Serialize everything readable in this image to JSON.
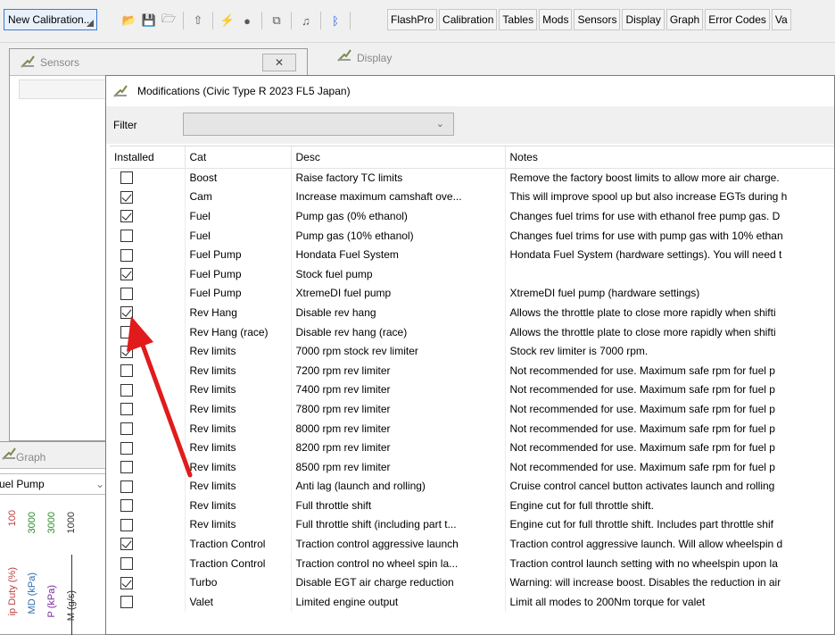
{
  "toolbar": {
    "new_calibration": "New Calibration...",
    "icons": [
      "open-folder-icon",
      "save-icon",
      "save-all-icon",
      "upload-icon",
      "flash-icon",
      "record-icon",
      "copy-icon",
      "music-icon",
      "bluetooth-icon"
    ],
    "menus": [
      "FlashPro",
      "Calibration",
      "Tables",
      "Mods",
      "Sensors",
      "Display",
      "Graph",
      "Error Codes",
      "Va"
    ]
  },
  "sensors_window": {
    "title": "Sensors",
    "close": "✕"
  },
  "display_window": {
    "title": "Display"
  },
  "graph_window": {
    "title": "Graph",
    "selected": "uel Pump",
    "axis_labels": [
      "100",
      "3000",
      "3000",
      "1000",
      "ip Duty (%)",
      "MD (kPa)",
      "P (kPa)",
      "M (g/s)"
    ]
  },
  "dialog": {
    "title": "Modifications (Civic Type R 2023 FL5 Japan)",
    "filter_label": "Filter",
    "filter_value": "",
    "columns": [
      "Installed",
      "Cat",
      "Desc",
      "Notes"
    ],
    "rows": [
      {
        "installed": false,
        "cat": "Boost",
        "desc": "Raise factory TC limits",
        "notes": "Remove the factory boost limits to allow more air charge."
      },
      {
        "installed": true,
        "cat": "Cam",
        "desc": "Increase maximum camshaft ove...",
        "notes": "This will improve spool up but also increase EGTs during h"
      },
      {
        "installed": true,
        "cat": "Fuel",
        "desc": "Pump gas (0% ethanol)",
        "notes": "Changes fuel trims for use with ethanol free pump gas.  D"
      },
      {
        "installed": false,
        "cat": "Fuel",
        "desc": "Pump gas (10% ethanol)",
        "notes": "Changes fuel trims for use with pump gas with 10% ethan"
      },
      {
        "installed": false,
        "cat": "Fuel Pump",
        "desc": "Hondata Fuel System",
        "notes": "Hondata Fuel System (hardware settings).  You will need t"
      },
      {
        "installed": true,
        "cat": "Fuel Pump",
        "desc": "Stock fuel pump",
        "notes": ""
      },
      {
        "installed": false,
        "cat": "Fuel Pump",
        "desc": "XtremeDI fuel pump",
        "notes": "XtremeDI fuel pump (hardware settings)"
      },
      {
        "installed": true,
        "cat": "Rev Hang",
        "desc": "Disable rev hang",
        "notes": "Allows the throttle plate to close more rapidly when shifti"
      },
      {
        "installed": false,
        "cat": "Rev Hang (race)",
        "desc": "Disable rev hang (race)",
        "notes": "Allows the throttle plate to close more rapidly when shifti"
      },
      {
        "installed": true,
        "cat": "Rev limits",
        "desc": "7000 rpm stock rev limiter",
        "notes": "Stock rev limiter is 7000 rpm."
      },
      {
        "installed": false,
        "cat": "Rev limits",
        "desc": "7200 rpm rev limiter",
        "notes": "Not recommended for use. Maximum safe rpm for fuel p"
      },
      {
        "installed": false,
        "cat": "Rev limits",
        "desc": "7400 rpm rev limiter",
        "notes": "Not recommended for use. Maximum safe rpm for fuel p"
      },
      {
        "installed": false,
        "cat": "Rev limits",
        "desc": "7800 rpm rev limiter",
        "notes": "Not recommended for use. Maximum safe rpm for fuel p"
      },
      {
        "installed": false,
        "cat": "Rev limits",
        "desc": "8000 rpm rev limiter",
        "notes": "Not recommended for use. Maximum safe rpm for fuel p"
      },
      {
        "installed": false,
        "cat": "Rev limits",
        "desc": "8200 rpm rev limiter",
        "notes": "Not recommended for use. Maximum safe rpm for fuel p"
      },
      {
        "installed": false,
        "cat": "Rev limits",
        "desc": "8500 rpm rev limiter",
        "notes": "Not recommended for use. Maximum safe rpm for fuel p"
      },
      {
        "installed": false,
        "cat": "Rev limits",
        "desc": "Anti lag (launch and rolling)",
        "notes": "Cruise control cancel button activates launch and rolling"
      },
      {
        "installed": false,
        "cat": "Rev limits",
        "desc": "Full throttle shift",
        "notes": "Engine cut for full throttle shift."
      },
      {
        "installed": false,
        "cat": "Rev limits",
        "desc": "Full throttle shift (including part t...",
        "notes": "Engine cut for full throttle shift.  Includes part throttle shif"
      },
      {
        "installed": true,
        "cat": "Traction Control",
        "desc": "Traction control aggressive launch",
        "notes": "Traction control aggressive launch.  Will allow wheelspin d"
      },
      {
        "installed": false,
        "cat": "Traction Control",
        "desc": "Traction control no wheel spin la...",
        "notes": "Traction control launch setting with no wheelspin upon la"
      },
      {
        "installed": true,
        "cat": "Turbo",
        "desc": "Disable EGT air charge reduction",
        "notes": "Warning: will increase boost.  Disables the reduction in air"
      },
      {
        "installed": false,
        "cat": "Valet",
        "desc": "Limited engine output",
        "notes": "Limit all modes to 200Nm torque for valet"
      }
    ]
  },
  "colors": {
    "arrow": "#e11b1b",
    "accent": "#3b7bd1"
  }
}
